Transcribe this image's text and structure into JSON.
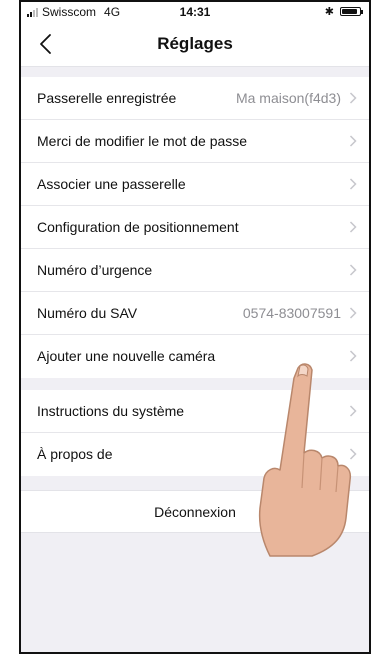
{
  "status": {
    "carrier": "Swisscom",
    "network": "4G",
    "time": "14:31"
  },
  "nav": {
    "title": "Réglages",
    "back_icon": "chevron-left-icon"
  },
  "groups": [
    {
      "rows": [
        {
          "label": "Passerelle enregistrée",
          "value": "Ma maison(f4d3)"
        },
        {
          "label": "Merci de modifier le mot de passe",
          "value": ""
        },
        {
          "label": "Associer une passerelle",
          "value": ""
        },
        {
          "label": "Configuration de positionnement",
          "value": ""
        },
        {
          "label": "Numéro d’urgence",
          "value": ""
        },
        {
          "label": "Numéro du SAV",
          "value": "0574-83007591"
        },
        {
          "label": "Ajouter une nouvelle caméra",
          "value": ""
        }
      ]
    },
    {
      "rows": [
        {
          "label": "Instructions du système",
          "value": ""
        },
        {
          "label": "À propos de",
          "value": ""
        }
      ]
    }
  ],
  "logout_label": "Déconnexion",
  "colors": {
    "background": "#f0eff4",
    "cell": "#ffffff",
    "secondary_text": "#8e8e93",
    "chevron": "#c7c7cc"
  }
}
